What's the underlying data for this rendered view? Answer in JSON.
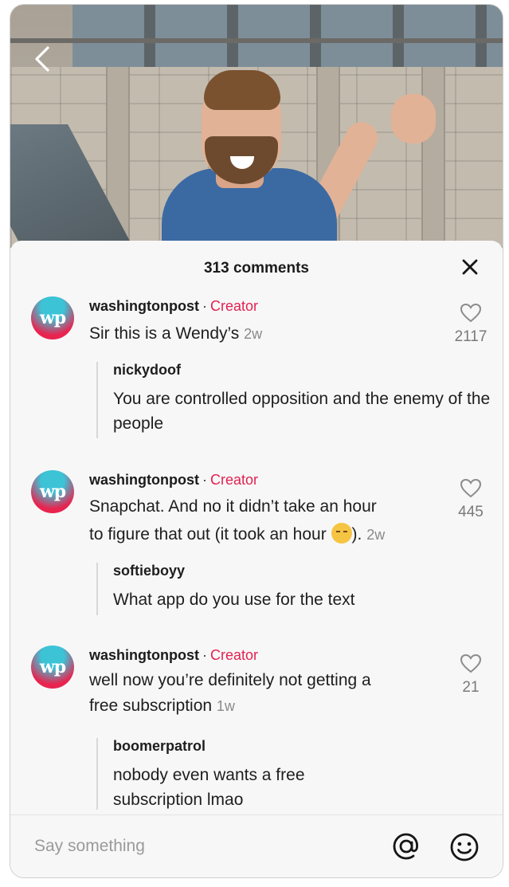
{
  "header": {
    "comment_count_label": "313 comments"
  },
  "comments": [
    {
      "author": "washingtonpost",
      "badge": "Creator",
      "avatar_text": "wp",
      "text": "Sir this is a Wendy’s",
      "time": "2w",
      "likes": "2117",
      "reply": {
        "author": "nickydoof",
        "text": "You are controlled opposition and the enemy of the people"
      }
    },
    {
      "author": "washingtonpost",
      "badge": "Creator",
      "avatar_text": "wp",
      "text_part1": "Snapchat. And no it didn’t take an hour",
      "text_part2": "to figure that out (it took an hour",
      "text_part3": ").",
      "emoji": "pensive-face-emoji",
      "time": "2w",
      "likes": "445",
      "reply": {
        "author": "softieboyy",
        "text": "What app do you use for the text"
      }
    },
    {
      "author": "washingtonpost",
      "badge": "Creator",
      "avatar_text": "wp",
      "text_part1": "well now you’re definitely not getting a",
      "text_part2": "free subscription",
      "time": "1w",
      "likes": "21",
      "reply": {
        "author": "boomerpatrol",
        "text": "nobody even wants a free subscription lmao"
      }
    }
  ],
  "input": {
    "placeholder": "Say something"
  },
  "icons": {
    "back": "chevron-left-icon",
    "close": "close-icon",
    "like": "heart-outline-icon",
    "mention": "at-sign-icon",
    "emoji": "smiley-icon"
  },
  "colors": {
    "creator_badge": "#e3214f",
    "sheet_bg": "#f7f7f8"
  }
}
